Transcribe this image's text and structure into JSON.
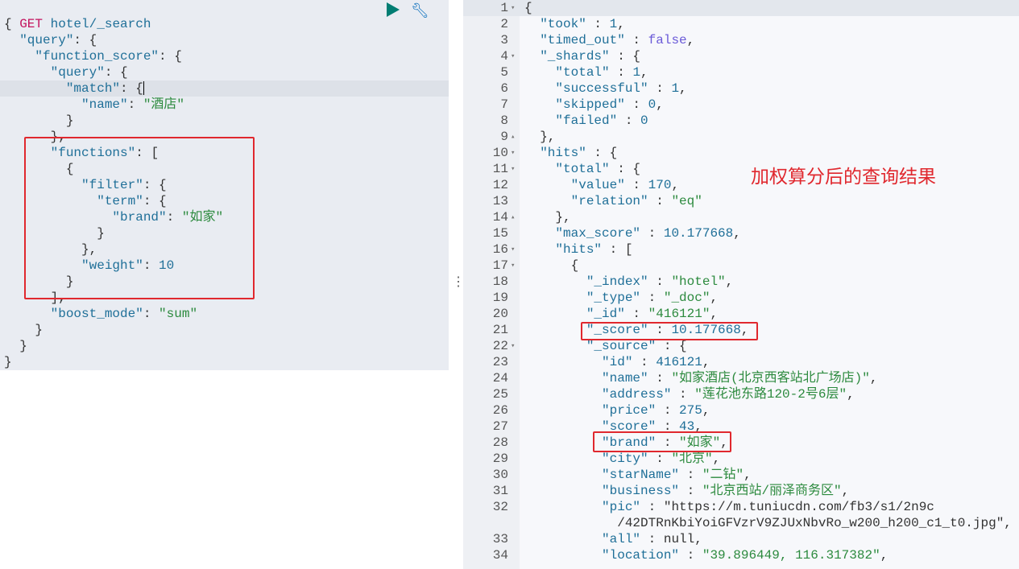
{
  "request": {
    "method": "GET",
    "path": "hotel/_search",
    "lines": [
      "{",
      "  \"query\": {",
      "    \"function_score\": {",
      "      \"query\": {",
      "        \"match\": {",
      "          \"name\": \"酒店\"",
      "        }",
      "      },",
      "      \"functions\": [",
      "        {",
      "          \"filter\": {",
      "            \"term\": {",
      "              \"brand\": \"如家\"",
      "            }",
      "          },",
      "          \"weight\": 10",
      "        }",
      "      ],",
      "      \"boost_mode\": \"sum\"",
      "    }",
      "  }",
      "}"
    ]
  },
  "toolbar": {
    "run_icon": "play-icon",
    "settings_icon": "wrench-icon"
  },
  "response": {
    "lines": [
      {
        "n": "1",
        "fold": "▾",
        "text": "{"
      },
      {
        "n": "2",
        "text": "  \"took\" : 1,"
      },
      {
        "n": "3",
        "text": "  \"timed_out\" : false,"
      },
      {
        "n": "4",
        "fold": "▾",
        "text": "  \"_shards\" : {"
      },
      {
        "n": "5",
        "text": "    \"total\" : 1,"
      },
      {
        "n": "6",
        "text": "    \"successful\" : 1,"
      },
      {
        "n": "7",
        "text": "    \"skipped\" : 0,"
      },
      {
        "n": "8",
        "text": "    \"failed\" : 0"
      },
      {
        "n": "9",
        "fold": "▴",
        "text": "  },"
      },
      {
        "n": "10",
        "fold": "▾",
        "text": "  \"hits\" : {"
      },
      {
        "n": "11",
        "fold": "▾",
        "text": "    \"total\" : {"
      },
      {
        "n": "12",
        "text": "      \"value\" : 170,"
      },
      {
        "n": "13",
        "text": "      \"relation\" : \"eq\""
      },
      {
        "n": "14",
        "fold": "▴",
        "text": "    },"
      },
      {
        "n": "15",
        "text": "    \"max_score\" : 10.177668,"
      },
      {
        "n": "16",
        "fold": "▾",
        "text": "    \"hits\" : ["
      },
      {
        "n": "17",
        "fold": "▾",
        "text": "      {"
      },
      {
        "n": "18",
        "text": "        \"_index\" : \"hotel\","
      },
      {
        "n": "19",
        "text": "        \"_type\" : \"_doc\","
      },
      {
        "n": "20",
        "text": "        \"_id\" : \"416121\","
      },
      {
        "n": "21",
        "text": "        \"_score\" : 10.177668,"
      },
      {
        "n": "22",
        "fold": "▾",
        "text": "        \"_source\" : {"
      },
      {
        "n": "23",
        "text": "          \"id\" : 416121,"
      },
      {
        "n": "24",
        "text": "          \"name\" : \"如家酒店(北京西客站北广场店)\","
      },
      {
        "n": "25",
        "text": "          \"address\" : \"莲花池东路120-2号6层\","
      },
      {
        "n": "26",
        "text": "          \"price\" : 275,"
      },
      {
        "n": "27",
        "text": "          \"score\" : 43,"
      },
      {
        "n": "28",
        "text": "          \"brand\" : \"如家\","
      },
      {
        "n": "29",
        "text": "          \"city\" : \"北京\","
      },
      {
        "n": "30",
        "text": "          \"starName\" : \"二钻\","
      },
      {
        "n": "31",
        "text": "          \"business\" : \"北京西站/丽泽商务区\","
      },
      {
        "n": "32",
        "text": "          \"pic\" : \"https://m.tuniucdn.com/fb3/s1/2n9c"
      },
      {
        "n": "",
        "text": "            /42DTRnKbiYoiGFVzrV9ZJUxNbvRo_w200_h200_c1_t0.jpg\","
      },
      {
        "n": "33",
        "text": "          \"all\" : null,"
      },
      {
        "n": "34",
        "text": "          \"location\" : \"39.896449, 116.317382\","
      }
    ]
  },
  "annotation": "加权算分后的查询结果",
  "colors": {
    "highlight_box": "#e0282e",
    "run": "#017d73"
  }
}
